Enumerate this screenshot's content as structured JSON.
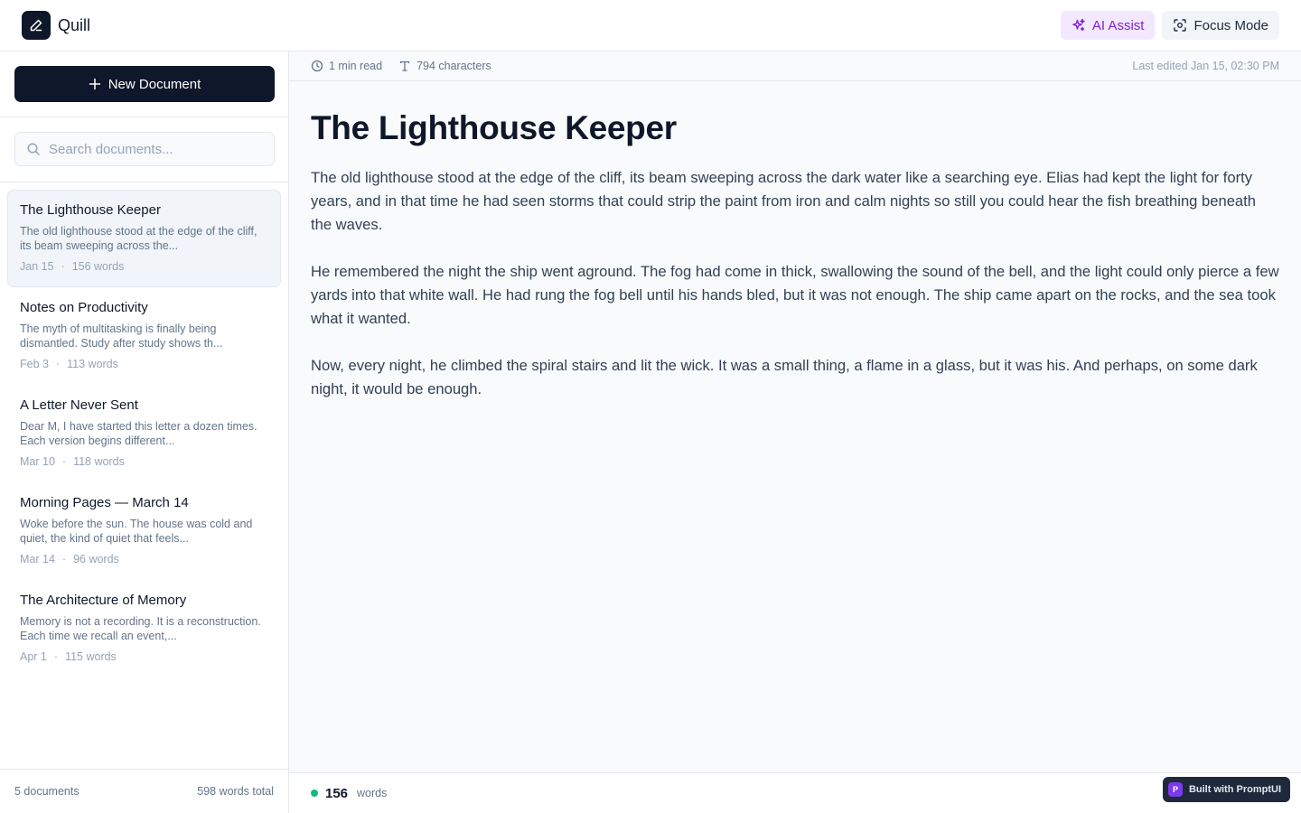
{
  "app": {
    "name": "Quill"
  },
  "header": {
    "ai_assist_label": "AI Assist",
    "focus_mode_label": "Focus Mode"
  },
  "sidebar": {
    "new_document_label": "New Document",
    "search_placeholder": "Search documents...",
    "documents": [
      {
        "title": "The Lighthouse Keeper",
        "excerpt": "The old lighthouse stood at the edge of the cliff, its beam sweeping across the...",
        "date": "Jan 15",
        "words": "156 words",
        "active": true
      },
      {
        "title": "Notes on Productivity",
        "excerpt": "The myth of multitasking is finally being dismantled. Study after study shows th...",
        "date": "Feb 3",
        "words": "113 words",
        "active": false
      },
      {
        "title": "A Letter Never Sent",
        "excerpt": "Dear M, I have started this letter a dozen times. Each version begins different...",
        "date": "Mar 10",
        "words": "118 words",
        "active": false
      },
      {
        "title": "Morning Pages — March 14",
        "excerpt": "Woke before the sun. The house was cold and quiet, the kind of quiet that feels...",
        "date": "Mar 14",
        "words": "96 words",
        "active": false
      },
      {
        "title": "The Architecture of Memory",
        "excerpt": "Memory is not a recording. It is a reconstruction. Each time we recall an event,...",
        "date": "Apr 1",
        "words": "115 words",
        "active": false
      }
    ],
    "footer": {
      "doc_count": "5 documents",
      "total_words": "598 words total"
    }
  },
  "editor": {
    "read_time": "1 min read",
    "characters": "794 characters",
    "last_edited": "Last edited Jan 15, 02:30 PM",
    "title": "The Lighthouse Keeper",
    "paragraphs": [
      "The old lighthouse stood at the edge of the cliff, its beam sweeping across the dark water like a searching eye. Elias had kept the light for forty years, and in that time he had seen storms that could strip the paint from iron and calm nights so still you could hear the fish breathing beneath the waves.",
      "He remembered the night the ship went aground. The fog had come in thick, swallowing the sound of the bell, and the light could only pierce a few yards into that white wall. He had rung the fog bell until his hands bled, but it was not enough. The ship came apart on the rocks, and the sea took what it wanted.",
      "Now, every night, he climbed the spiral stairs and lit the wick. It was a small thing, a flame in a glass, but it was his. And perhaps, on some dark night, it would be enough."
    ]
  },
  "status": {
    "word_count": "156",
    "word_label": "words"
  },
  "badge": {
    "letter": "P",
    "label": "Built with PromptUI"
  }
}
